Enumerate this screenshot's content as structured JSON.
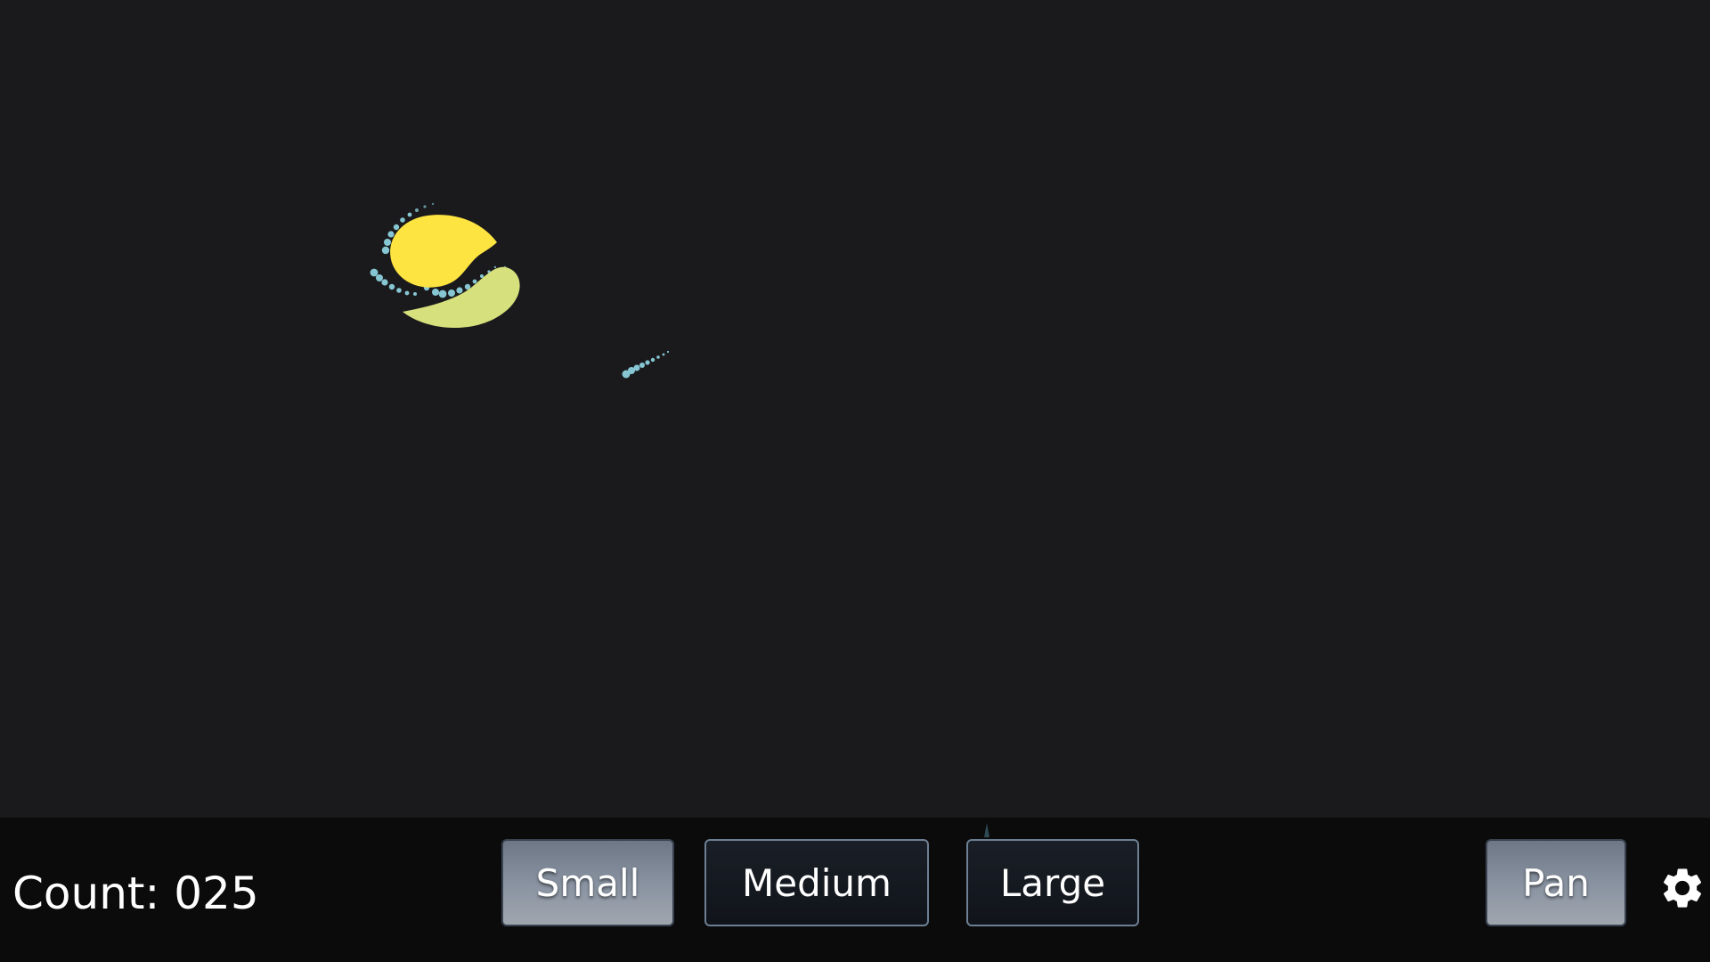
{
  "hud": {
    "count_label": "Count: 025"
  },
  "toolbar": {
    "buttons": [
      {
        "label": "Small",
        "state": "active"
      },
      {
        "label": "Medium",
        "state": "inactive"
      },
      {
        "label": "Large",
        "state": "inactive"
      },
      {
        "label": "Pan",
        "state": "active"
      }
    ],
    "settings_icon": "gear-icon"
  },
  "colors": {
    "background": "#1a1a1d",
    "toolbar_background": "#0b0b0c",
    "creature_primary": "#fde440",
    "creature_secondary": "#d6e07c",
    "particle_trail": "#86c6d2"
  }
}
